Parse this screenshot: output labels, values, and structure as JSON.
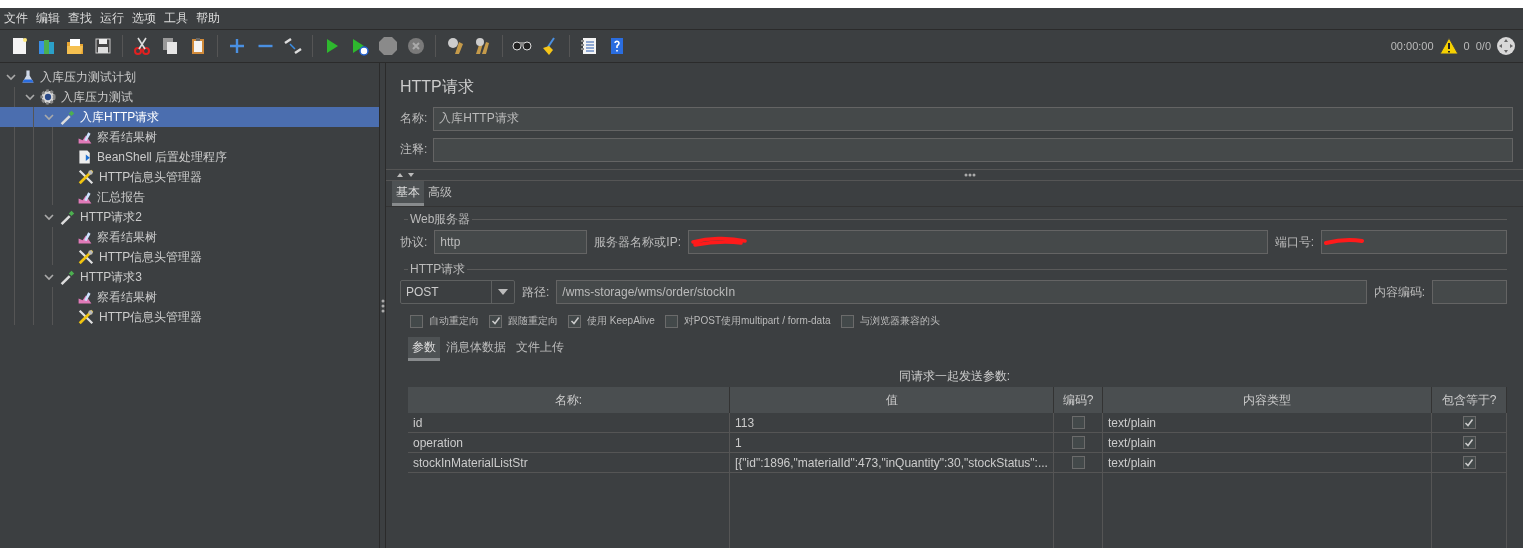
{
  "menu": [
    "文件",
    "编辑",
    "查找",
    "运行",
    "选项",
    "工具",
    "帮助"
  ],
  "status": {
    "time": "00:00:00",
    "warnings": "0",
    "threads": "0/0"
  },
  "tree": [
    {
      "label": "入库压力测试计划",
      "kind": "test_plan",
      "selected": false,
      "expanded": true,
      "children": [
        {
          "label": "入库压力测试",
          "kind": "thread_group",
          "selected": false,
          "expanded": true,
          "children": [
            {
              "label": "入库HTTP请求",
              "kind": "sampler",
              "selected": true,
              "expanded": true,
              "children": [
                {
                  "label": "察看结果树",
                  "kind": "listener",
                  "selected": false
                },
                {
                  "label": "BeanShell 后置处理程序",
                  "kind": "postprocessor",
                  "selected": false
                },
                {
                  "label": "HTTP信息头管理器",
                  "kind": "config",
                  "selected": false
                },
                {
                  "label": "汇总报告",
                  "kind": "listener",
                  "selected": false
                }
              ]
            },
            {
              "label": "HTTP请求2",
              "kind": "sampler",
              "selected": false,
              "expanded": true,
              "children": [
                {
                  "label": "察看结果树",
                  "kind": "listener",
                  "selected": false
                },
                {
                  "label": "HTTP信息头管理器",
                  "kind": "config",
                  "selected": false
                }
              ]
            },
            {
              "label": "HTTP请求3",
              "kind": "sampler",
              "selected": false,
              "expanded": true,
              "children": [
                {
                  "label": "察看结果树",
                  "kind": "listener",
                  "selected": false
                },
                {
                  "label": "HTTP信息头管理器",
                  "kind": "config",
                  "selected": false
                }
              ]
            }
          ]
        }
      ]
    }
  ],
  "panel": {
    "title": "HTTP请求",
    "name": {
      "label": "名称:",
      "value": "入库HTTP请求"
    },
    "comment": {
      "label": "注释:"
    },
    "tabs": [
      {
        "label": "基本",
        "selected": true
      },
      {
        "label": "高级",
        "selected": false
      }
    ],
    "web_server": {
      "heading": "Web服务器",
      "protocol": {
        "label": "协议:",
        "value": "http"
      },
      "server": {
        "label": "服务器名称或IP:"
      },
      "port": {
        "label": "端口号:"
      }
    },
    "http_request": {
      "heading": "HTTP请求",
      "method": "POST",
      "path": {
        "label": "路径:",
        "value": "/wms-storage/wms/order/stockIn"
      },
      "encoding": {
        "label": "内容编码:"
      },
      "options": [
        {
          "label": "自动重定向",
          "checked": false
        },
        {
          "label": "跟随重定向",
          "checked": true
        },
        {
          "label": "使用 KeepAlive",
          "checked": true
        },
        {
          "label": "对POST使用multipart / form-data",
          "checked": false
        },
        {
          "label": "与浏览器兼容的头",
          "checked": false
        }
      ]
    },
    "subtabs": [
      {
        "label": "参数",
        "selected": true
      },
      {
        "label": "消息体数据",
        "selected": false
      },
      {
        "label": "文件上传",
        "selected": false
      }
    ],
    "params_caption": "同请求一起发送参数:",
    "table": {
      "columns": [
        "名称:",
        "值",
        "编码?",
        "内容类型",
        "包含等于?"
      ],
      "rows": [
        {
          "name": "id",
          "value": "113",
          "encode": false,
          "content_type": "text/plain",
          "include_equals": true
        },
        {
          "name": "operation",
          "value": "1",
          "encode": false,
          "content_type": "text/plain",
          "include_equals": true
        },
        {
          "name": "stockInMaterialListStr",
          "value": "[{\"id\":1896,\"materialId\":473,\"inQuantity\":30,\"stockStatus\":...",
          "encode": false,
          "content_type": "text/plain",
          "include_equals": true
        }
      ]
    }
  }
}
